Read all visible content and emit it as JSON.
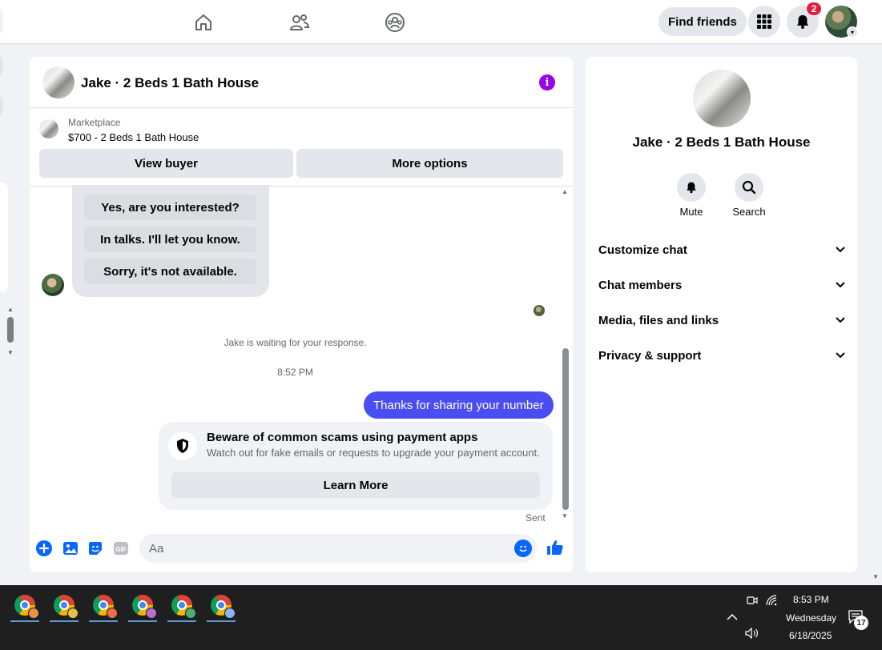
{
  "topnav": {
    "find_friends": "Find friends",
    "notification_count": "2",
    "icons": [
      "home-icon",
      "friends-icon",
      "groups-icon",
      "menu-grid-icon",
      "bell-icon"
    ]
  },
  "chat": {
    "title": "Jake · 2 Beds 1 Bath House",
    "marketplace_label": "Marketplace",
    "listing": "$700 - 2 Beds 1 Bath House",
    "view_buyer": "View buyer",
    "more_options": "More options",
    "quick_replies": [
      "Yes, are you interested?",
      "In talks. I'll let you know.",
      "Sorry, it's not available."
    ],
    "waiting": "Jake is waiting for your response.",
    "timestamp": "8:52 PM",
    "outgoing_message": "Thanks for sharing your number",
    "scam_title": "Beware of common scams using payment apps",
    "scam_subtitle": "Watch out for fake emails or requests to upgrade your payment account.",
    "learn_more": "Learn More",
    "sent_status": "Sent",
    "composer_placeholder": "Aa",
    "gif_label": "GIF"
  },
  "info_panel": {
    "title": "Jake · 2 Beds 1 Bath House",
    "actions": [
      "Mute",
      "Search"
    ],
    "sections": [
      "Customize chat",
      "Chat members",
      "Media, files and links",
      "Privacy & support"
    ]
  },
  "taskbar": {
    "time": "8:53 PM",
    "day": "Wednesday",
    "date": "6/18/2025",
    "notification_count": "17",
    "profile_colors": [
      "#e8914a",
      "#e2c04a",
      "#e8704a",
      "#b56fd6",
      "#4caf6d",
      "#8ab4f8"
    ]
  },
  "colors": {
    "accent": "#0866ff",
    "outgoing_bubble": "#4a4ef0",
    "info_icon": "#9b00e8",
    "badge": "#e41e3f"
  }
}
